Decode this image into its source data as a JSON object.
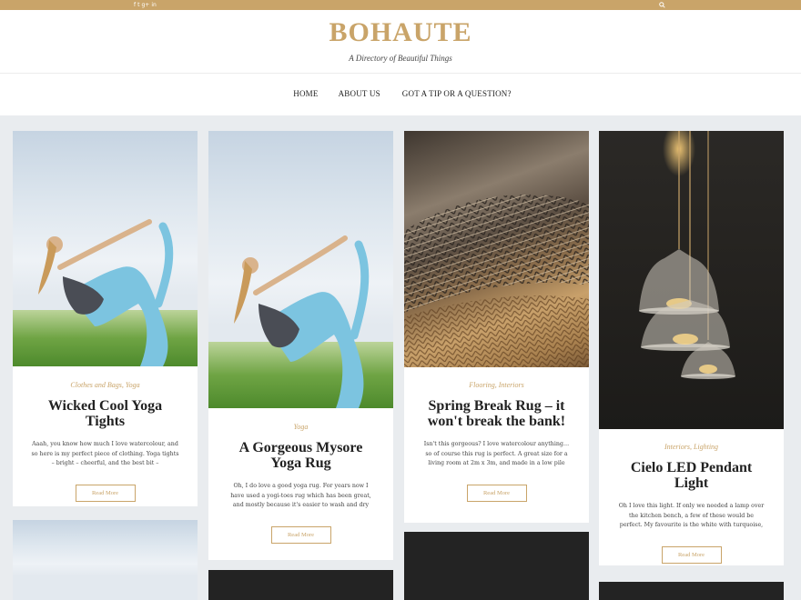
{
  "topbar": {
    "social": [
      "f",
      "t",
      "g+",
      "in"
    ],
    "search_icon": "search-icon"
  },
  "site": {
    "title": "BOHAUTE",
    "tagline": "A Directory of Beautiful Things"
  },
  "nav": [
    {
      "label": "HOME"
    },
    {
      "label": "ABOUT US"
    },
    {
      "label": "GOT A TIP OR A QUESTION?"
    }
  ],
  "posts": [
    {
      "categories": "Clothes and Bags, Yoga",
      "title": "Wicked Cool Yoga Tights",
      "excerpt": "Aaah, you know how much I love watercolour, and so here is my perfect piece of clothing.  Yoga tights – bright – cheerful, and the best bit – WATERCOLOR.",
      "button": "Read More",
      "image": "yoga-woman-photo"
    },
    {
      "categories": "Yoga",
      "title": "A Gorgeous Mysore Yoga Rug",
      "excerpt": "Oh, I do love a good yoga rug.  For years now I have used a yogi-toes rug which has been great, and mostly because it's easier to wash and dry quickly.",
      "button": "Read More",
      "image": "yoga-woman-photo"
    },
    {
      "categories": "Flooring, Interiors",
      "title": "Spring Break Rug – it won't break the bank!",
      "excerpt": "Isn't this gorgeous?  I love watercolour anything…so of course this rug is perfect.  A great size for a living room at 2m x 3m, and made in a low pile chenille it'll",
      "button": "Read More",
      "image": "patterned-rug-photo"
    },
    {
      "categories": "Interiors, Lighting",
      "title": "Cielo LED Pendant Light",
      "excerpt": "Oh I love this light.  If only we needed a lamp over the kitchen bench, a few of these would be perfect.  My favourite is the white with turquoise, but any",
      "button": "Read More",
      "image": "pendant-lights-photo"
    }
  ],
  "colors": {
    "accent": "#c9a469",
    "background": "#e9ecef"
  }
}
